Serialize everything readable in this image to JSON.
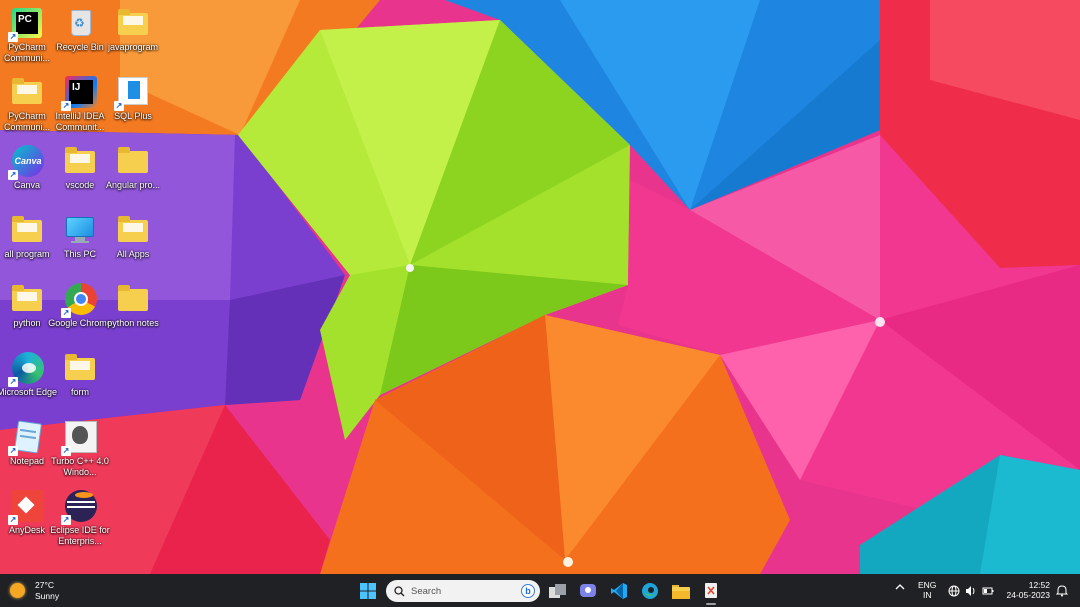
{
  "desktop": {
    "icons": [
      {
        "label": "PyCharm Communi...",
        "icon": "pycharm-icon",
        "shortcut": true
      },
      {
        "label": "Recycle Bin",
        "icon": "recycle-bin-icon",
        "shortcut": false
      },
      {
        "label": "javaprogram",
        "icon": "folder-icon",
        "shortcut": false
      },
      {
        "label": "PyCharm Communi...",
        "icon": "folder-icon",
        "shortcut": false
      },
      {
        "label": "IntelliJ IDEA Communit...",
        "icon": "intellij-icon",
        "shortcut": true
      },
      {
        "label": "SQL Plus",
        "icon": "sqlplus-icon",
        "shortcut": true
      },
      {
        "label": "Canva",
        "icon": "canva-icon",
        "shortcut": true
      },
      {
        "label": "vscode",
        "icon": "folder-icon",
        "shortcut": false
      },
      {
        "label": "Angular pro...",
        "icon": "folder-icon",
        "shortcut": false
      },
      {
        "label": "all program",
        "icon": "folder-icon",
        "shortcut": false
      },
      {
        "label": "This PC",
        "icon": "this-pc-icon",
        "shortcut": false
      },
      {
        "label": "All Apps",
        "icon": "folder-icon",
        "shortcut": false
      },
      {
        "label": "python",
        "icon": "folder-icon",
        "shortcut": false
      },
      {
        "label": "Google Chrome",
        "icon": "chrome-icon",
        "shortcut": true
      },
      {
        "label": "python notes",
        "icon": "folder-icon",
        "shortcut": false
      },
      {
        "label": "Microsoft Edge",
        "icon": "edge-icon",
        "shortcut": true
      },
      {
        "label": "form",
        "icon": "folder-icon",
        "shortcut": false
      },
      {
        "label": "Notepad",
        "icon": "notepad-icon",
        "shortcut": true
      },
      {
        "label": "Turbo C++ 4.0 Windo...",
        "icon": "turbo-cpp-icon",
        "shortcut": true
      },
      {
        "label": "AnyDesk",
        "icon": "anydesk-icon",
        "shortcut": true
      },
      {
        "label": "Eclipse IDE for Enterpris...",
        "icon": "eclipse-icon",
        "shortcut": true
      }
    ]
  },
  "taskbar": {
    "weather": {
      "temp": "27°C",
      "condition": "Sunny"
    },
    "search_placeholder": "Search",
    "apps": [
      "start-icon",
      "search",
      "task-view-icon",
      "teams-chat-icon",
      "vscode-icon",
      "edge-icon",
      "file-explorer-icon",
      "snipping-tool-icon"
    ],
    "lang_top": "ENG",
    "lang_bottom": "IN",
    "time": "12:52",
    "date": "24-05-2023"
  }
}
